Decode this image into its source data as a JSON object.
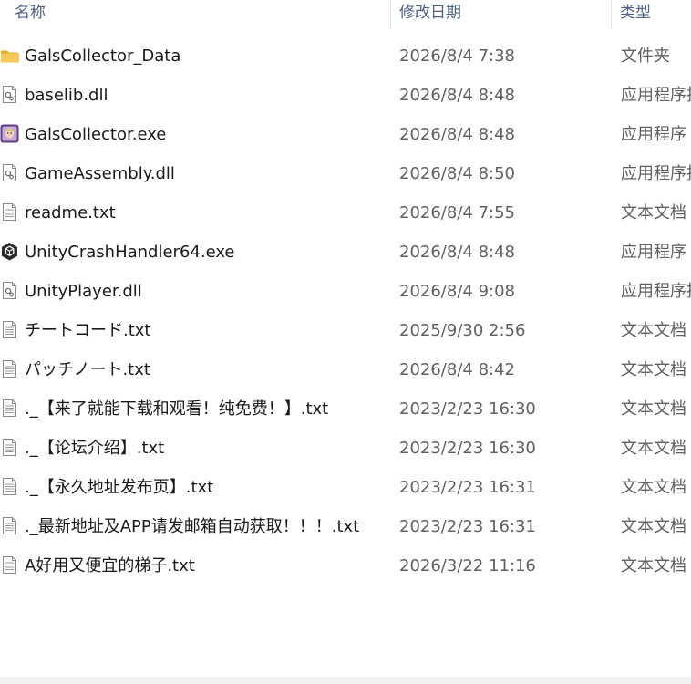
{
  "header": {
    "name": "名称",
    "date": "修改日期",
    "type": "类型"
  },
  "files": [
    {
      "icon": "folder-icon",
      "name": "GalsCollector_Data",
      "date": "2026/8/4 7:38",
      "type": "文件夹"
    },
    {
      "icon": "dll-file-icon",
      "name": "baselib.dll",
      "date": "2026/8/4 8:48",
      "type": "应用程序扩展"
    },
    {
      "icon": "app-exe-icon",
      "name": "GalsCollector.exe",
      "date": "2026/8/4 8:48",
      "type": "应用程序"
    },
    {
      "icon": "dll-file-icon",
      "name": "GameAssembly.dll",
      "date": "2026/8/4 8:50",
      "type": "应用程序扩展"
    },
    {
      "icon": "text-file-icon",
      "name": "readme.txt",
      "date": "2026/8/4 7:55",
      "type": "文本文档"
    },
    {
      "icon": "unity-exe-icon",
      "name": "UnityCrashHandler64.exe",
      "date": "2026/8/4 8:48",
      "type": "应用程序"
    },
    {
      "icon": "dll-file-icon",
      "name": "UnityPlayer.dll",
      "date": "2026/8/4 9:08",
      "type": "应用程序扩展"
    },
    {
      "icon": "text-file-icon",
      "name": "チートコード.txt",
      "date": "2025/9/30 2:56",
      "type": "文本文档"
    },
    {
      "icon": "text-file-icon",
      "name": "パッチノート.txt",
      "date": "2026/8/4 8:42",
      "type": "文本文档"
    },
    {
      "icon": "text-file-icon",
      "name": "._【来了就能下载和观看！纯免费！】.txt",
      "date": "2023/2/23 16:30",
      "type": "文本文档"
    },
    {
      "icon": "text-file-icon",
      "name": "._【论坛介绍】.txt",
      "date": "2023/2/23 16:30",
      "type": "文本文档"
    },
    {
      "icon": "text-file-icon",
      "name": "._【永久地址发布页】.txt",
      "date": "2023/2/23 16:31",
      "type": "文本文档"
    },
    {
      "icon": "text-file-icon",
      "name": "._最新地址及APP请发邮箱自动获取！！！.txt",
      "date": "2023/2/23 16:31",
      "type": "文本文档"
    },
    {
      "icon": "text-file-icon",
      "name": "A好用又便宜的梯子.txt",
      "date": "2026/3/22 11:16",
      "type": "文本文档"
    }
  ],
  "colors": {
    "header_text": "#4d6189",
    "name_text": "#1a1a1a",
    "detail_text": "#606060",
    "folder": "#f5c542"
  }
}
